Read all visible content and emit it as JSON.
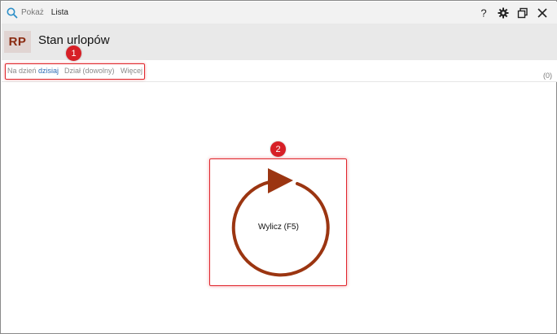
{
  "titlebar": {
    "pokaz": "Pokaż",
    "lista": "Lista",
    "buttons": [
      "help-icon",
      "gear-icon",
      "restore-window-icon",
      "close-icon"
    ]
  },
  "header": {
    "badge": "RP",
    "title": "Stan urlopów"
  },
  "filters": {
    "date_prefix": "Na dzień",
    "date_value": "dzisiaj",
    "department": "Dział (dowolny)",
    "more": "Więcej",
    "count": "(0)"
  },
  "callouts": {
    "one": "1",
    "two": "2"
  },
  "calc": {
    "label": "Wylicz (F5)",
    "color": "#9b3511"
  },
  "colors": {
    "accent_red": "#d71f26",
    "link_blue": "#2d6db5"
  }
}
